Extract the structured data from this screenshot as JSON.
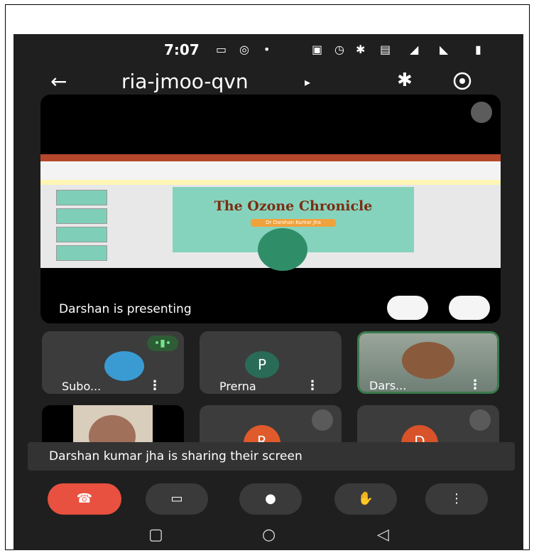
{
  "status": {
    "time": "7:07"
  },
  "meeting": {
    "code": "ria-jmoo-qvn"
  },
  "presentation": {
    "slide_title": "The Ozone Chronicle",
    "slide_subtitle": "Dr Darshan Kumar Jha",
    "presenting_label": "Darshan is presenting"
  },
  "participants": [
    {
      "name": "Subo...",
      "letter": ""
    },
    {
      "name": "Prerna",
      "letter": "P"
    },
    {
      "name": "Dars...",
      "letter": ""
    },
    {
      "name": "",
      "letter": ""
    },
    {
      "name": "",
      "letter": "R"
    },
    {
      "name": "",
      "letter": "D"
    }
  ],
  "toast": "Darshan kumar jha is sharing their screen",
  "colors": {
    "end_call": "#e8503f",
    "background": "#1f1f1f",
    "speaking": "#6fe58a"
  },
  "icons": [
    "back-arrow-icon",
    "bluetooth-icon",
    "camera-flip-icon",
    "mic-off-icon",
    "pin-icon",
    "fullscreen-icon",
    "end-call-icon",
    "camera-icon",
    "mic-icon",
    "raise-hand-icon",
    "more-icon"
  ]
}
